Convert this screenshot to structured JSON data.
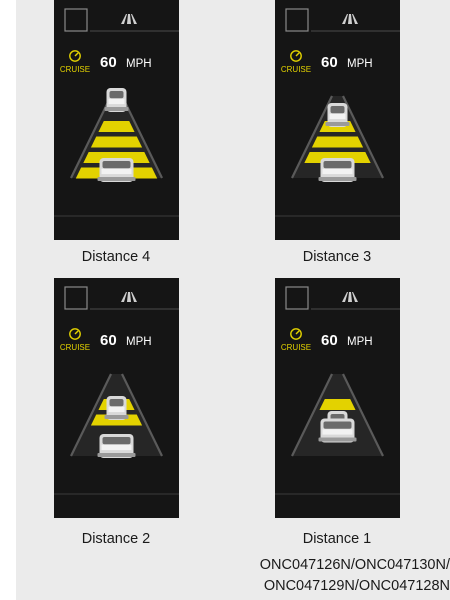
{
  "colors": {
    "panel_bg": "#151515",
    "accent_yellow": "#e3d200",
    "text_white": "#ffffff",
    "lane_gray": "#5a5a5a"
  },
  "panels": [
    {
      "id": "distance-4",
      "cruise_label": "CRUISE",
      "speed_value": "60",
      "speed_unit": "MPH",
      "icons": [
        "square-icon",
        "lane-icon",
        "cruise-icon"
      ],
      "bars_count": 4,
      "caption": "Distance 4"
    },
    {
      "id": "distance-3",
      "cruise_label": "CRUISE",
      "speed_value": "60",
      "speed_unit": "MPH",
      "icons": [
        "square-icon",
        "lane-icon",
        "cruise-icon"
      ],
      "bars_count": 3,
      "caption": "Distance 3"
    },
    {
      "id": "distance-2",
      "cruise_label": "CRUISE",
      "speed_value": "60",
      "speed_unit": "MPH",
      "icons": [
        "square-icon",
        "lane-icon",
        "cruise-icon"
      ],
      "bars_count": 2,
      "caption": "Distance 2"
    },
    {
      "id": "distance-1",
      "cruise_label": "CRUISE",
      "speed_value": "60",
      "speed_unit": "MPH",
      "icons": [
        "square-icon",
        "lane-icon",
        "cruise-icon"
      ],
      "bars_count": 1,
      "caption": "Distance 1"
    }
  ],
  "image_codes": [
    "ONC047126N/ONC047130N/",
    "ONC047129N/ONC047128N"
  ]
}
